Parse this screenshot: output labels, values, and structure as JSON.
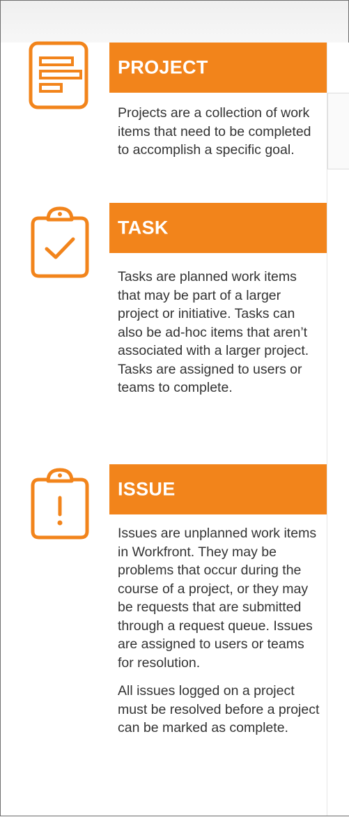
{
  "sections": [
    {
      "icon": "project-list-icon",
      "title": "PROJECT",
      "paragraphs": [
        "Projects are a collection of work items that need to be completed to accomplish a specific goal."
      ]
    },
    {
      "icon": "clipboard-check-icon",
      "title": "TASK",
      "paragraphs": [
        "Tasks are planned work items that may be part of a larger project or initiative. Tasks can also be ad-hoc items that aren’t associated with a larger project. Tasks are assigned to users or teams to complete."
      ]
    },
    {
      "icon": "clipboard-exclamation-icon",
      "title": "ISSUE",
      "paragraphs": [
        "Issues are unplanned work items in Workfront. They may be problems that occur during the course of a project, or they may be requests that are submitted through a request queue. Issues are assigned to users or teams for resolution.",
        "All issues logged on a project must be resolved before a project can be marked as complete."
      ]
    }
  ],
  "colors": {
    "accent": "#f2841b",
    "text": "#333333"
  }
}
